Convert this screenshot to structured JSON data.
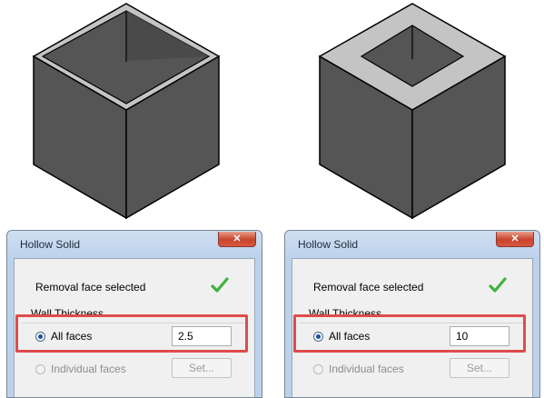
{
  "figures": [
    {
      "cube": {
        "shell": "thin-wall"
      },
      "dialog": {
        "title": "Hollow Solid",
        "close_icon": "close-icon",
        "removal_face_label": "Removal face selected",
        "status_icon": "checkmark-icon",
        "wall_thickness_label": "Wall Thickness",
        "all_faces_label": "All faces",
        "all_faces_selected": true,
        "thickness_value": "2.5",
        "individual_faces_label": "Individual faces",
        "set_button_label": "Set..."
      }
    },
    {
      "cube": {
        "shell": "thick-wall"
      },
      "dialog": {
        "title": "Hollow Solid",
        "close_icon": "close-icon",
        "removal_face_label": "Removal face selected",
        "status_icon": "checkmark-icon",
        "wall_thickness_label": "Wall Thickness",
        "all_faces_label": "All faces",
        "all_faces_selected": true,
        "thickness_value": "10",
        "individual_faces_label": "Individual faces",
        "set_button_label": "Set..."
      }
    }
  ],
  "colors": {
    "cube_face": "#555555",
    "cube_edge": "#000000",
    "rim": "#c4c4c4",
    "highlight": "#e04b4b",
    "check": "#3fb33f"
  }
}
